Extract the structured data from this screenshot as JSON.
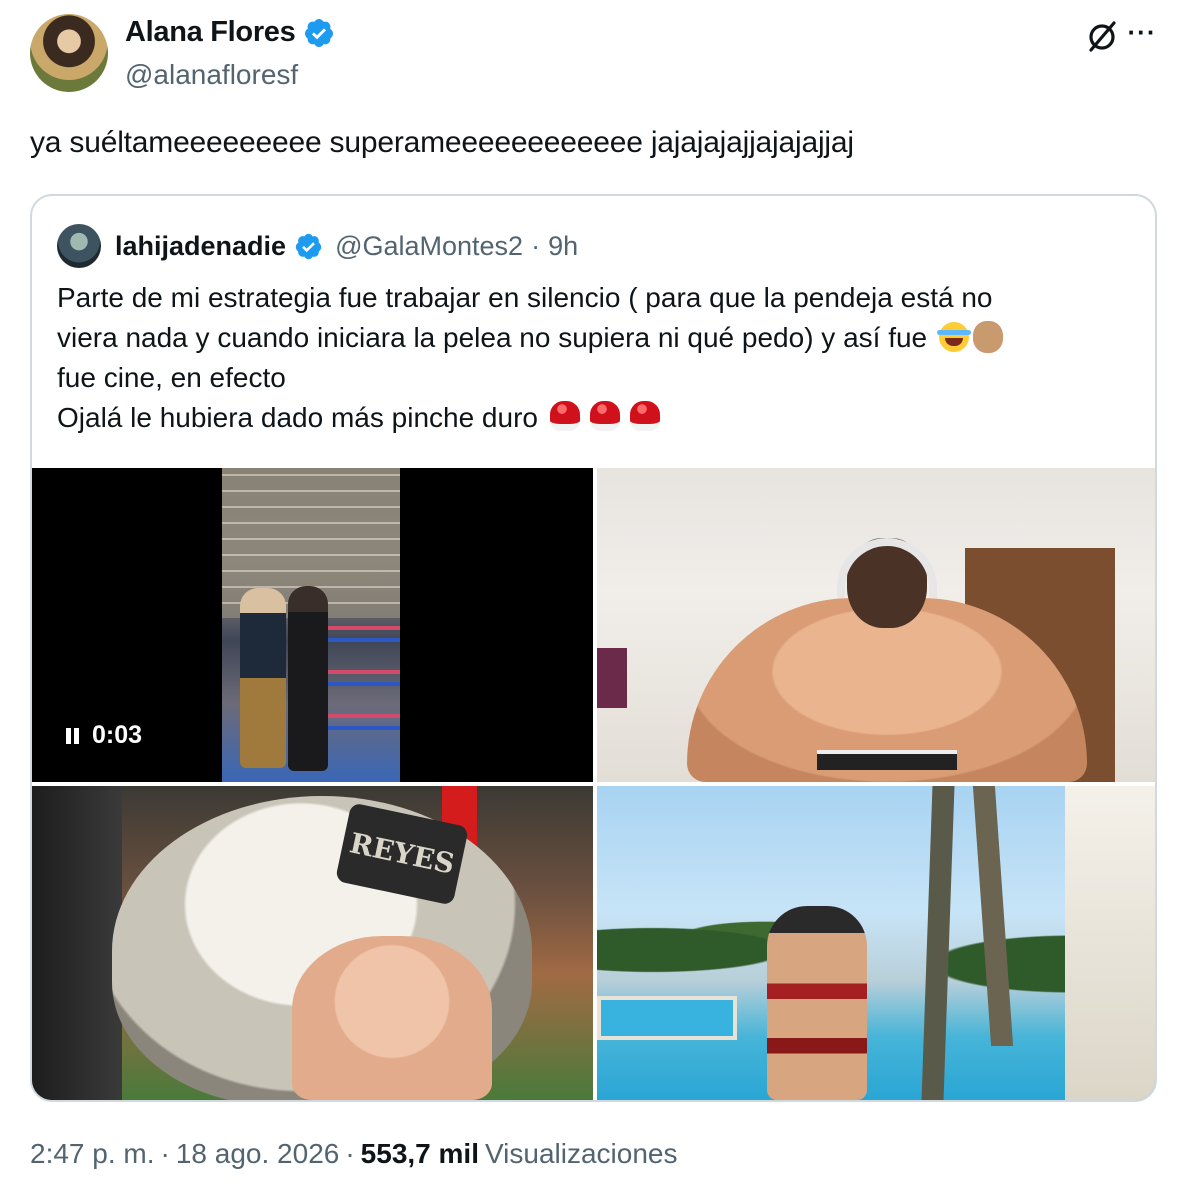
{
  "author": {
    "name": "Alana Flores",
    "handle": "@alanafloresf",
    "verified": true
  },
  "header_icons": {
    "grok": "slashed-circle-icon",
    "more": "more-icon",
    "more_glyph": "···"
  },
  "tweet": {
    "text": "ya suéltameeeeeeeee superameeeeeeeeeeee jajajajajjajajajjaj"
  },
  "quoted": {
    "name": "lahijadenadie",
    "handle": "@GalaMontes2",
    "separator": "·",
    "time": "9h",
    "lines": [
      "Parte de mi estrategia fue trabajar en silencio ( para que la pendeja está no",
      "viera nada y cuando iniciara la pelea no supiera ni qué pedo) y así fue",
      "fue cine, en efecto",
      "Ojalá le hubiera dado más pinche duro"
    ],
    "emojis": {
      "line2": [
        "face-with-tears-of-joy",
        "pinching-hand-medium-skin-tone"
      ],
      "line4": [
        "boxing-glove",
        "boxing-glove",
        "boxing-glove"
      ]
    },
    "media": {
      "video_duration": "0:03",
      "video_state": "playing",
      "helmet_brand": "REYES"
    }
  },
  "footer": {
    "time": "2:47 p. m.",
    "sep1": "·",
    "date": "18 ago. 2026",
    "sep2": "·",
    "views_count": "553,7 mil",
    "views_label": "Visualizaciones"
  },
  "colors": {
    "verified_blue": "#1d9bf0",
    "secondary_text": "#536471",
    "border": "#cfd9de"
  }
}
